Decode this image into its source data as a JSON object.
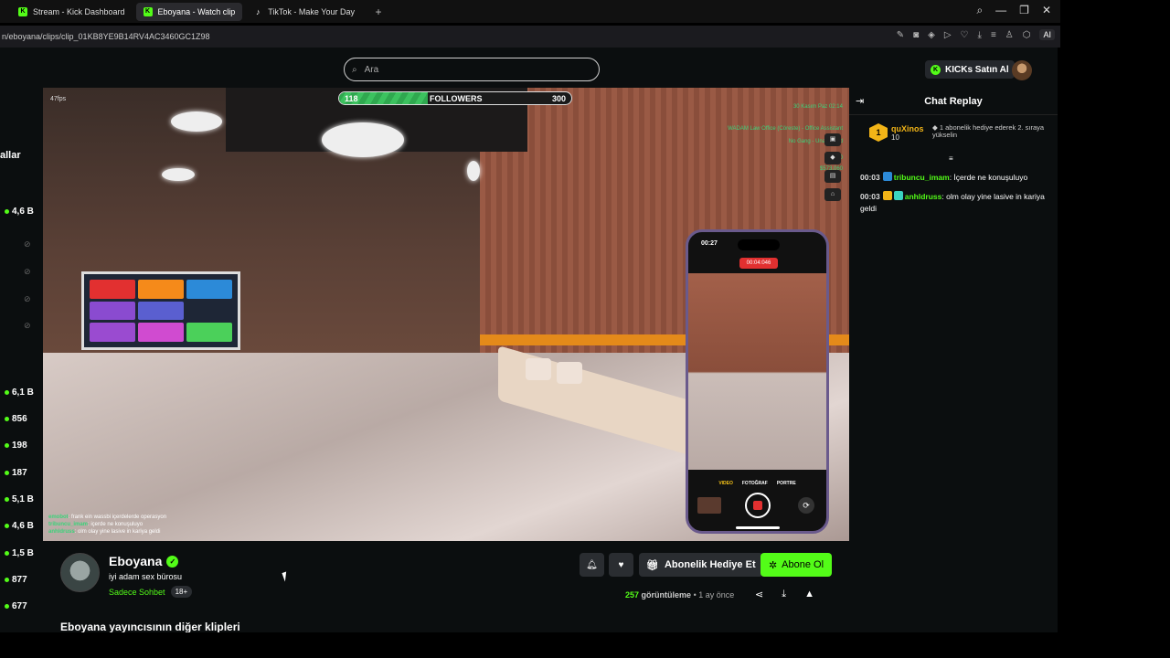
{
  "browser": {
    "tabs": [
      {
        "label": "Stream - Kick Dashboard",
        "favicon": "K"
      },
      {
        "label": "Eboyana - Watch clip",
        "favicon": "K"
      },
      {
        "label": "TikTok - Make Your Day",
        "favicon": "♪"
      }
    ],
    "new_tab": "+",
    "url": "n/eboyana/clips/clip_01KB8YE9B14RV4AC3460GC1Z98",
    "ai_label": "AI"
  },
  "header": {
    "search_placeholder": "Ara",
    "kicks_button": "KICKs Satın Al"
  },
  "sidebar": {
    "heading": "allar",
    "stats": [
      "4,6 B",
      "6,1 B",
      "856",
      "198",
      "187",
      "5,1 B",
      "4,6 B",
      "1,5 B",
      "877",
      "677"
    ]
  },
  "video": {
    "fps": "47fps",
    "followers_current": "118",
    "followers_label": "FOLLOWERS",
    "followers_goal": "300",
    "followers_progress": 0.38,
    "hud": [
      "30 Kasım Paz 02:14",
      "WADAM Law Office (Cöreste) - Office Assistant",
      "No Gang - Unaffiliated",
      "$50",
      "$50",
      "$573,060"
    ],
    "tv_apps": [
      "YouTube",
      "SoundCloud",
      "",
      "twitch",
      "facebook",
      "dailymotion",
      "vimeo",
      "MP4",
      "MP4"
    ],
    "phone": {
      "time": "00:27",
      "recording": "00:04:046",
      "modes": [
        "VIDEO",
        "FOTOĞRAF",
        "PORTRE"
      ]
    },
    "ingame_chat": [
      {
        "user": "emobot",
        "text": ": frank ein wassbi içerdelerde operasyon"
      },
      {
        "user": "tribuncu_imam",
        "text": ": içerde ne konuşuluyo"
      },
      {
        "user": "anhldruss",
        "text": ": olm olay yine lasive in kariya geldi"
      }
    ]
  },
  "channel": {
    "name": "Eboyana",
    "title": "iyi adam sex bürosu",
    "category": "Sadece Sohbet",
    "age_badge": "18+",
    "gift_button": "Abonelik Hediye Et",
    "subscribe_button": "Abone Ol",
    "views_count": "257",
    "views_label": "görüntüleme",
    "time_ago": "• 1 ay önce",
    "more_clips": "Eboyana yayıncısının diğer klipleri"
  },
  "chat": {
    "title": "Chat Replay",
    "top_gifter": {
      "rank": "1",
      "name": "quXinos",
      "count": "10",
      "message": "1 abonelik hediye ederek 2. sıraya yükselin"
    },
    "messages": [
      {
        "time": "00:03",
        "user": "tribuncu_imam",
        "text": "İçerde ne konuşuluyo"
      },
      {
        "time": "00:03",
        "user": "anhldruss",
        "text": "olm olay yine lasive in kariya geldi"
      }
    ]
  },
  "colors": {
    "kick_green": "#53fc18",
    "gold": "#f2b417",
    "background": "#0b0e0f"
  }
}
